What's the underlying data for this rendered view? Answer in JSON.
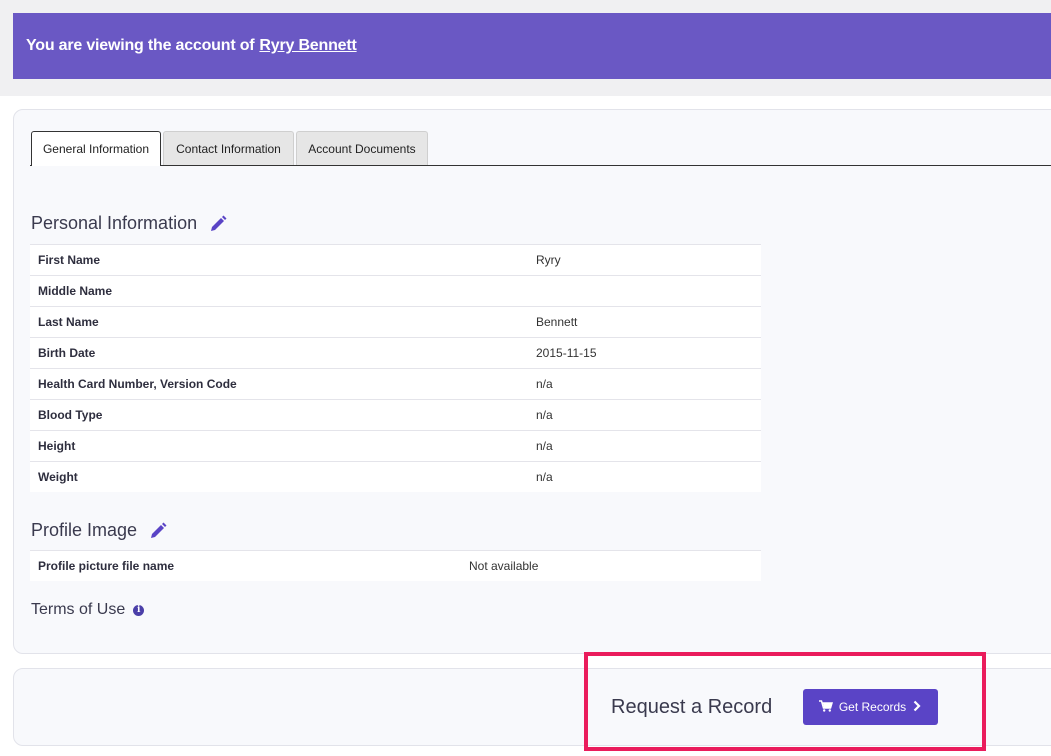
{
  "banner": {
    "prefix": "You are viewing the account of",
    "account_name": "Ryry Bennett"
  },
  "tabs": [
    {
      "label": "General Information",
      "active": true
    },
    {
      "label": "Contact Information",
      "active": false
    },
    {
      "label": "Account Documents",
      "active": false
    }
  ],
  "personal": {
    "title": "Personal Information",
    "rows": [
      {
        "label": "First Name",
        "value": "Ryry"
      },
      {
        "label": "Middle Name",
        "value": ""
      },
      {
        "label": "Last Name",
        "value": "Bennett"
      },
      {
        "label": "Birth Date",
        "value": "2015-11-15"
      },
      {
        "label": "Health Card Number, Version Code",
        "value": "n/a"
      },
      {
        "label": "Blood Type",
        "value": "n/a"
      },
      {
        "label": "Height",
        "value": "n/a"
      },
      {
        "label": "Weight",
        "value": "n/a"
      }
    ]
  },
  "profile": {
    "title": "Profile Image",
    "rows": [
      {
        "label": "Profile picture file name",
        "value": "Not available"
      }
    ]
  },
  "terms": {
    "title": "Terms of Use"
  },
  "request": {
    "title": "Request a Record",
    "button_label": "Get Records"
  },
  "colors": {
    "banner": "#6a58c4",
    "accent": "#5a44c6",
    "highlight": "#ea1c5c"
  },
  "icons": {
    "edit": "pencil-icon",
    "info": "info-icon",
    "cart": "cart-icon",
    "chevron": "chevron-right-icon"
  }
}
